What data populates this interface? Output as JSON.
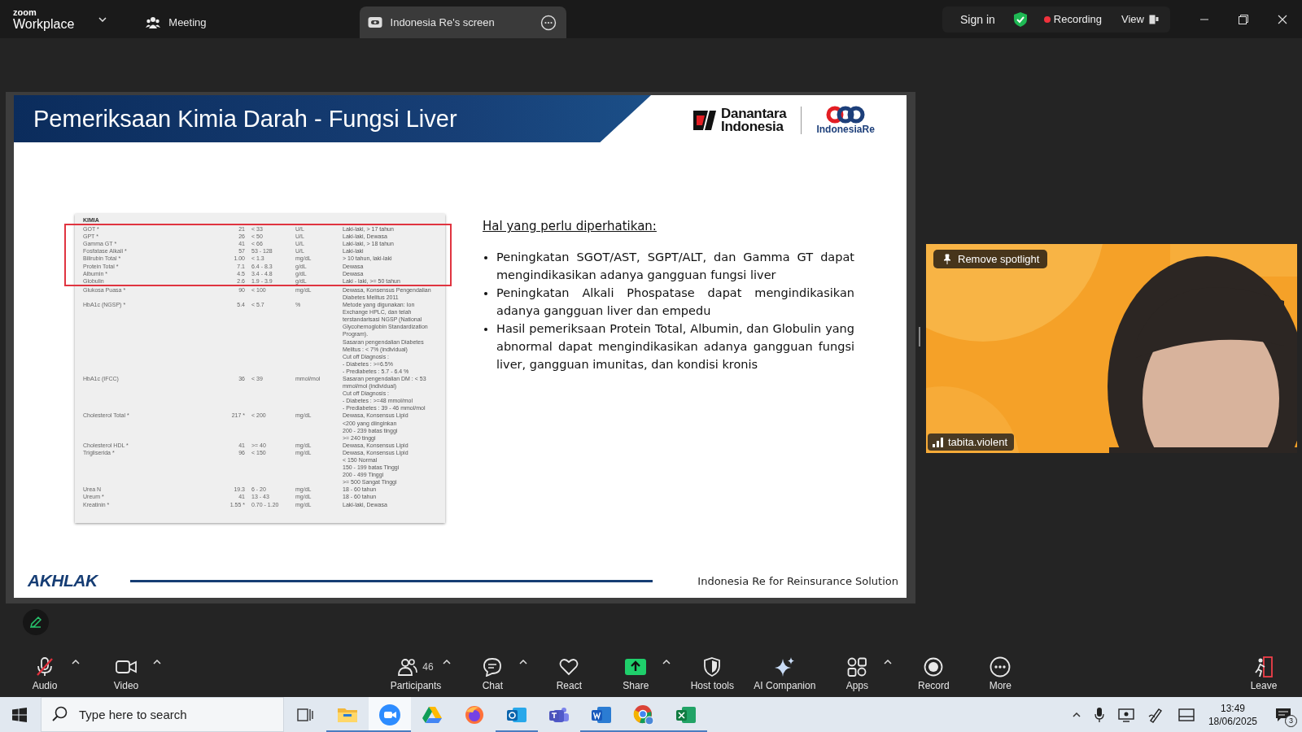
{
  "title_bar": {
    "logo_mark": "zoom",
    "product": "Workplace",
    "tabs": [
      {
        "kind": "meeting",
        "label": "Meeting",
        "selected": false
      },
      {
        "kind": "screen",
        "label": "Indonesia Re's screen",
        "selected": true
      }
    ],
    "sign_in": "Sign in",
    "recording": "Recording",
    "view": "View"
  },
  "slide": {
    "title": "Pemeriksaan Kimia Darah - Fungsi Liver",
    "logo_left": [
      "Danantara",
      "Indonesia"
    ],
    "logo_right": "IndonesiaRe",
    "lab_report": {
      "section": "KIMIA",
      "highlight_box": {
        "rows": [
          {
            "name": "GOT *",
            "result": "21",
            "range": "< 33",
            "unit": "U/L",
            "note": "Laki-laki, > 17 tahun"
          },
          {
            "name": "GPT *",
            "result": "26",
            "range": "< 50",
            "unit": "U/L",
            "note": "Laki-laki, Dewasa"
          },
          {
            "name": "Gamma GT *",
            "result": "41",
            "range": "< 66",
            "unit": "U/L",
            "note": "Laki-laki, > 18 tahun"
          },
          {
            "name": "Fosfatase Alkali *",
            "result": "57",
            "range": "53 - 128",
            "unit": "U/L",
            "note": "Laki-laki"
          },
          {
            "name": "Bilirubin Total *",
            "result": "1.00",
            "range": "< 1.3",
            "unit": "mg/dL",
            "note": "> 10 tahun, laki-laki"
          },
          {
            "name": "Protein Total *",
            "result": "7.1",
            "range": "6.4 - 8.3",
            "unit": "g/dL",
            "note": "Dewasa"
          },
          {
            "name": "Albumin *",
            "result": "4.5",
            "range": "3.4 - 4.8",
            "unit": "g/dL",
            "note": "Dewasa"
          },
          {
            "name": "Globulin",
            "result": "2.6",
            "range": "1.9 - 3.9",
            "unit": "g/dL",
            "note": "Laki - laki, >= 50 tahun"
          }
        ]
      },
      "rows": [
        {
          "name": "Glukosa Puasa *",
          "result": "90",
          "range": "< 100",
          "unit": "mg/dL",
          "note": "Dewasa, Konsensus Pengendalian\nDiabetes Melitus 2011"
        },
        {
          "name": "HbA1c (NGSP) *",
          "result": "5.4",
          "range": "< 5.7",
          "unit": "%",
          "note": "Metode yang digunakan: Ion\nExchange HPLC, dan telah\nterstandarisasi NGSP (National\nGlycohemoglobin Standardization\nProgram).\nSasaran pengendalian Diabetes\nMelitus : < 7% (individual)\nCut off Diagnosis :\n- Diabetes : >=6.5%\n- Prediabetes : 5.7 - 6.4 %"
        },
        {
          "name": "HbA1c (IFCC)",
          "result": "36",
          "range": "< 39",
          "unit": "mmol/mol",
          "note": "Sasaran pengendalian DM : < 53\nmmol/mol (individual)\nCut off Diagnosis :\n- Diabetes : >=48 mmol/mol\n- Prediabetes : 39 - 46 mmol/mol"
        },
        {
          "name": "Cholesterol Total *",
          "result": "217 *",
          "range": "< 200",
          "unit": "mg/dL",
          "note": "Dewasa, Konsensus Lipid\n<200 yang diinginkan\n200 - 239 batas tinggi\n>= 240 tinggi"
        },
        {
          "name": "Cholesterol HDL *",
          "result": "41",
          "range": ">= 40",
          "unit": "mg/dL",
          "note": "Dewasa, Konsensus Lipid"
        },
        {
          "name": "Trigliserida *",
          "result": "96",
          "range": "< 150",
          "unit": "mg/dL",
          "note": "Dewasa, Konsensus Lipid\n< 150 Normal\n150 - 199 batas Tinggi\n200 - 499 Tinggi\n>= 500 Sangat Tinggi"
        },
        {
          "name": "Urea N",
          "result": "19.3",
          "range": "6 - 20",
          "unit": "mg/dL",
          "note": "18 - 60 tahun"
        },
        {
          "name": "Ureum *",
          "result": "41",
          "range": "13 - 43",
          "unit": "mg/dL",
          "note": "18 - 60 tahun"
        },
        {
          "name": "Kreatinin *",
          "result": "1.55 *",
          "range": "0.70 - 1.20",
          "unit": "mg/dL",
          "note": "Laki-laki, Dewasa"
        }
      ]
    },
    "notes_heading": "Hal yang perlu diperhatikan:",
    "bullets": [
      "Peningkatan SGOT/AST, SGPT/ALT, dan Gamma GT dapat mengindikasikan adanya gangguan fungsi liver",
      "Peningkatan Alkali Phospatase dapat mengindikasikan adanya gangguan liver dan empedu",
      "Hasil pemeriksaan Protein Total, Albumin, dan Globulin yang abnormal dapat mengindikasikan adanya gangguan fungsi liver, gangguan imunitas, dan kondisi kronis"
    ],
    "footer_logo": "AKHLAK",
    "footer_text": "Indonesia Re for Reinsurance Solution"
  },
  "video_tile": {
    "kind": "picture",
    "spotlight_button": "Remove spotlight",
    "participant": "tabita.violent"
  },
  "toolbar": [
    {
      "kind": "audio",
      "label": "Audio",
      "muted": true,
      "caret": true
    },
    {
      "kind": "video",
      "label": "Video",
      "muted": false,
      "caret": true
    },
    {
      "kind": "participants",
      "label": "Participants",
      "count": "46",
      "caret": true
    },
    {
      "kind": "chat",
      "label": "Chat",
      "caret": true
    },
    {
      "kind": "react",
      "label": "React",
      "caret": false
    },
    {
      "kind": "share",
      "label": "Share",
      "caret": true
    },
    {
      "kind": "host_tools",
      "label": "Host tools",
      "caret": false
    },
    {
      "kind": "ai_companion",
      "label": "AI Companion",
      "caret": false
    },
    {
      "kind": "apps",
      "label": "Apps",
      "caret": true
    },
    {
      "kind": "record",
      "label": "Record",
      "caret": false
    },
    {
      "kind": "more",
      "label": "More",
      "caret": false
    },
    {
      "kind": "leave",
      "label": "Leave",
      "caret": false
    }
  ],
  "taskbar": {
    "search_placeholder": "Type here to search",
    "apps": [
      {
        "kind": "explorer",
        "running": true,
        "selected": false
      },
      {
        "kind": "zoom",
        "running": true,
        "selected": true
      },
      {
        "kind": "drive",
        "running": false,
        "selected": false
      },
      {
        "kind": "firefox",
        "running": false,
        "selected": false
      },
      {
        "kind": "outlook",
        "running": true,
        "selected": false
      },
      {
        "kind": "teams",
        "running": false,
        "selected": false
      },
      {
        "kind": "word",
        "running": true,
        "selected": false
      },
      {
        "kind": "chrome",
        "running": true,
        "selected": false
      },
      {
        "kind": "excel",
        "running": true,
        "selected": false
      }
    ],
    "time": "13:49",
    "date": "18/06/2025",
    "notifications": "3"
  }
}
